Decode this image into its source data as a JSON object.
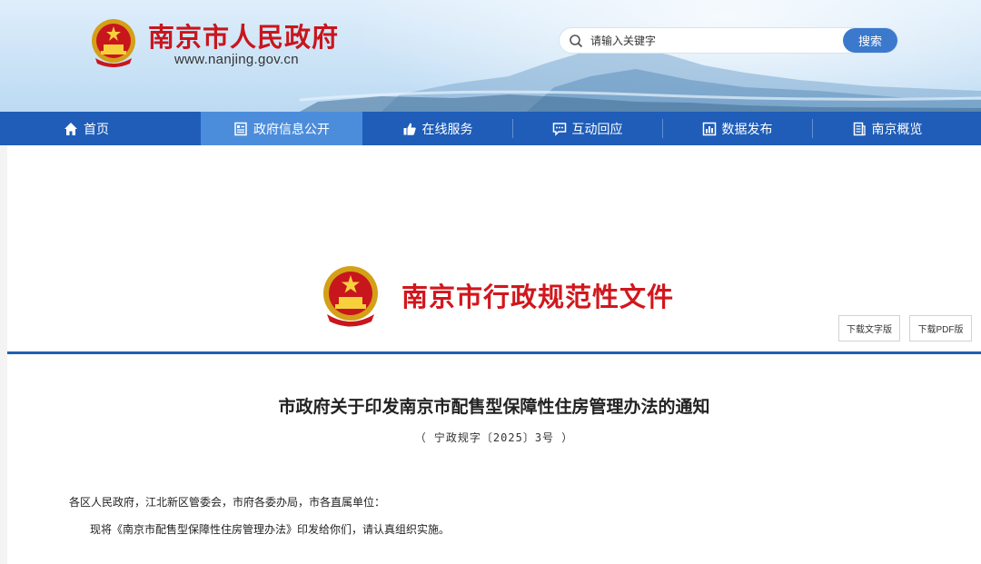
{
  "header": {
    "site_title": "南京市人民政府",
    "site_url": "www.nanjing.gov.cn",
    "search": {
      "placeholder": "请输入关键字",
      "button_label": "搜索"
    }
  },
  "nav": {
    "items": [
      {
        "label": "首页",
        "icon": "home-icon"
      },
      {
        "label": "政府信息公开",
        "icon": "document-list-icon",
        "active": true
      },
      {
        "label": "在线服务",
        "icon": "thumbs-up-icon"
      },
      {
        "label": "互动回应",
        "icon": "chat-bubble-icon"
      },
      {
        "label": "数据发布",
        "icon": "bar-chart-icon"
      },
      {
        "label": "南京概览",
        "icon": "document-icon"
      }
    ]
  },
  "document": {
    "banner_title": "南京市行政规范性文件",
    "download_word_label": "下载文字版",
    "download_pdf_label": "下载PDF版",
    "title": "市政府关于印发南京市配售型保障性住房管理办法的通知",
    "number": "（ 宁政规字〔2025〕3号 ）",
    "salutation": "各区人民政府，江北新区管委会，市府各委办局，市各直属单位：",
    "body": "现将《南京市配售型保障性住房管理办法》印发给你们，请认真组织实施。"
  },
  "colors": {
    "nav_bg": "#1f5db8",
    "nav_active": "#4c8ddb",
    "brand_red": "#c8161d",
    "search_button": "#3b79cc",
    "divider_blue": "#1e5fb4"
  }
}
